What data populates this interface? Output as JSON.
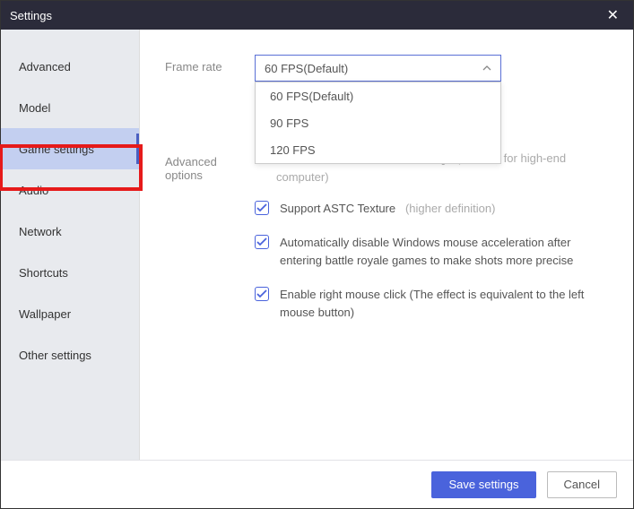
{
  "window": {
    "title": "Settings"
  },
  "sidebar": {
    "items": [
      {
        "label": "Advanced"
      },
      {
        "label": "Model"
      },
      {
        "label": "Game settings"
      },
      {
        "label": "Audio"
      },
      {
        "label": "Network"
      },
      {
        "label": "Shortcuts"
      },
      {
        "label": "Wallpaper"
      },
      {
        "label": "Other settings"
      }
    ],
    "active_index": 2
  },
  "content": {
    "frame_rate": {
      "label": "Frame rate",
      "selected": "60 FPS(Default)",
      "options": [
        "60 FPS(Default)",
        "90 FPS",
        "120 FPS"
      ]
    },
    "advanced_options": {
      "label": "Advanced options",
      "partial_text_suffix": "g",
      "hint_visible": "(suitable for high-end computer)",
      "checks": [
        {
          "label": "Support ASTC Texture",
          "hint": "(higher definition)",
          "checked": true
        },
        {
          "label": "Automatically disable Windows mouse acceleration after entering battle royale games to make shots more precise",
          "hint": "",
          "checked": true
        },
        {
          "label": "Enable right mouse click (The effect is equivalent to the left mouse button)",
          "hint": "",
          "checked": true
        }
      ]
    }
  },
  "footer": {
    "save": "Save settings",
    "cancel": "Cancel"
  }
}
